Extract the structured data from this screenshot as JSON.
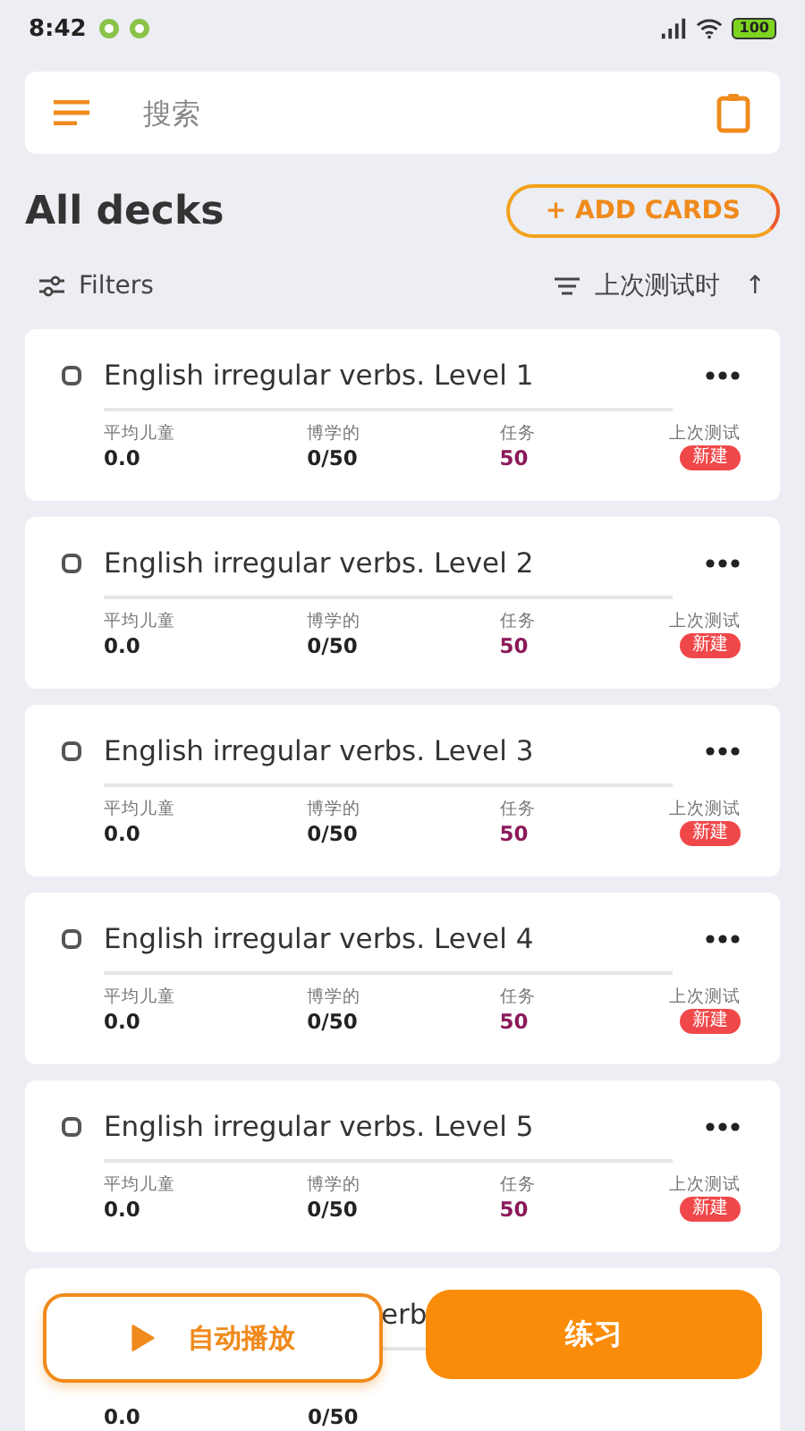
{
  "status_bar": {
    "time": "8:42",
    "battery": "100"
  },
  "search": {
    "placeholder": "搜索"
  },
  "header": {
    "title": "All decks",
    "add_button": "+ ADD CARDS"
  },
  "toolbar": {
    "filters": "Filters",
    "sort": "上次测试时",
    "sort_arrow": "↑"
  },
  "decks": [
    {
      "kind": "full",
      "title": "English irregular verbs. Level 1",
      "stats": [
        {
          "label": "平均儿童",
          "value": "0.0",
          "kind": "plain"
        },
        {
          "label": "博学的",
          "value": "0/50",
          "kind": "plain"
        },
        {
          "label": "任务",
          "value": "50",
          "kind": "accent"
        },
        {
          "label": "上次测试",
          "value": "新建",
          "kind": "badge"
        }
      ]
    },
    {
      "kind": "full",
      "title": "English irregular verbs. Level 2",
      "stats": [
        {
          "label": "平均儿童",
          "value": "0.0",
          "kind": "plain"
        },
        {
          "label": "博学的",
          "value": "0/50",
          "kind": "plain"
        },
        {
          "label": "任务",
          "value": "50",
          "kind": "accent"
        },
        {
          "label": "上次测试",
          "value": "新建",
          "kind": "badge"
        }
      ]
    },
    {
      "kind": "full",
      "title": "English irregular verbs. Level 3",
      "stats": [
        {
          "label": "平均儿童",
          "value": "0.0",
          "kind": "plain"
        },
        {
          "label": "博学的",
          "value": "0/50",
          "kind": "plain"
        },
        {
          "label": "任务",
          "value": "50",
          "kind": "accent"
        },
        {
          "label": "上次测试",
          "value": "新建",
          "kind": "badge"
        }
      ]
    },
    {
      "kind": "full",
      "title": "English irregular verbs. Level 4",
      "stats": [
        {
          "label": "平均儿童",
          "value": "0.0",
          "kind": "plain"
        },
        {
          "label": "博学的",
          "value": "0/50",
          "kind": "plain"
        },
        {
          "label": "任务",
          "value": "50",
          "kind": "accent"
        },
        {
          "label": "上次测试",
          "value": "新建",
          "kind": "badge"
        }
      ]
    },
    {
      "kind": "full",
      "title": "English irregular verbs. Level 5",
      "stats": [
        {
          "label": "平均儿童",
          "value": "0.0",
          "kind": "plain"
        },
        {
          "label": "博学的",
          "value": "0/50",
          "kind": "plain"
        },
        {
          "label": "任务",
          "value": "50",
          "kind": "accent"
        },
        {
          "label": "上次测试",
          "value": "新建",
          "kind": "badge"
        }
      ]
    },
    {
      "kind": "partial",
      "title": "erb",
      "stats": [
        {
          "value": "0.0",
          "kind": "plain"
        },
        {
          "value": "0/50",
          "kind": "plain"
        }
      ]
    }
  ],
  "bottom_buttons": {
    "autoplay": "自动播放",
    "practice": "练习"
  }
}
